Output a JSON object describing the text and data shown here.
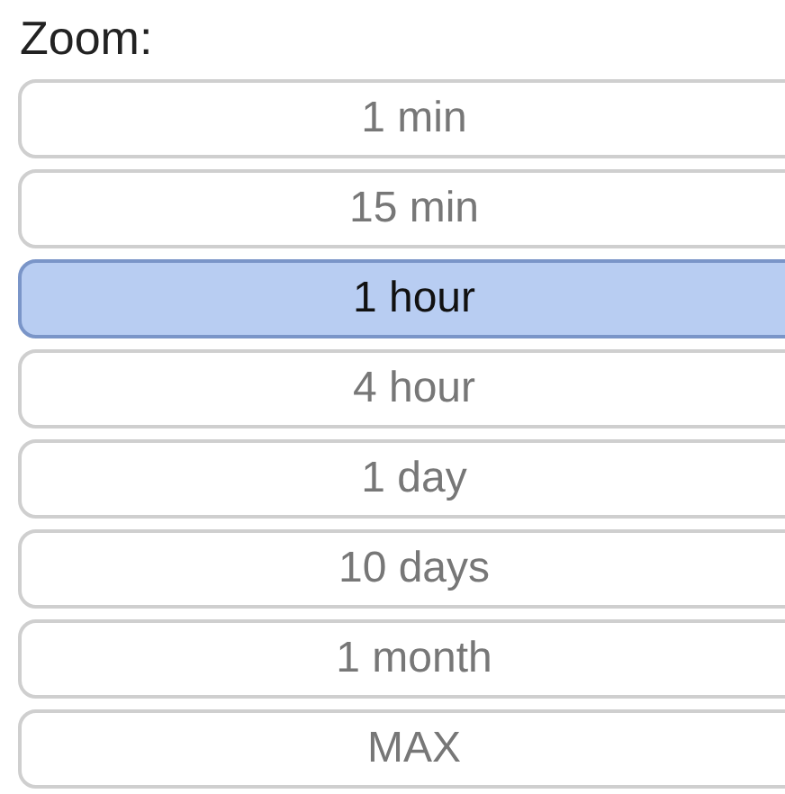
{
  "label": "Zoom:",
  "options": [
    {
      "label": "1 min",
      "selected": false
    },
    {
      "label": "15 min",
      "selected": false
    },
    {
      "label": "1 hour",
      "selected": true
    },
    {
      "label": "4 hour",
      "selected": false
    },
    {
      "label": "1 day",
      "selected": false
    },
    {
      "label": "10 days",
      "selected": false
    },
    {
      "label": "1 month",
      "selected": false
    },
    {
      "label": "MAX",
      "selected": false
    }
  ]
}
